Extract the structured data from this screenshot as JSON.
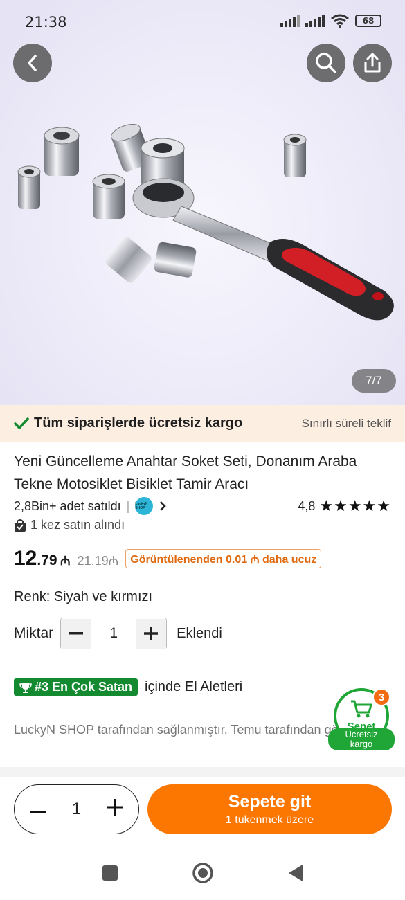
{
  "status": {
    "time": "21:38",
    "battery": "68"
  },
  "gallery": {
    "counter": "7/7"
  },
  "shipping": {
    "free_text": "Tüm siparişlerde ücretsiz kargo",
    "offer": "Sınırlı süreli teklif"
  },
  "product": {
    "title": "Yeni Güncelleme Anahtar Soket Seti, Donanım Araba Tekne Motosiklet Bisiklet Tamir Aracı",
    "sold": "2,8Bin+ adet satıldı",
    "shop_logo_text": "LuckyN SHOP",
    "rating": "4,8",
    "bought": "1 kez satın alındı",
    "price_int": "12",
    "price_dec": ".79",
    "currency": "₼",
    "old_price": "21.19₼",
    "cheaper": "Görüntülenenden 0.01 ₼ daha ucuz",
    "color_label": "Renk: Siyah ve kırmızı",
    "qty_label": "Miktar",
    "qty_value": "1",
    "added_label": "Eklendi",
    "best_badge": "#3 En Çok Satan",
    "best_category": "içinde El Aletleri",
    "supplied": "LuckyN SHOP tarafından sağlanmıştır. Temu tarafından gönderildi."
  },
  "cart_float": {
    "label": "Sepet",
    "count": "3",
    "free_line1": "Ücretsiz",
    "free_line2": "kargo"
  },
  "bottom": {
    "qty_value": "1",
    "go_cart": "Sepete git",
    "stock_note": "1 tükenmek üzere"
  },
  "colors": {
    "accent": "#fb7701",
    "green": "#1fa637",
    "ship_bg": "#fdeee2"
  }
}
